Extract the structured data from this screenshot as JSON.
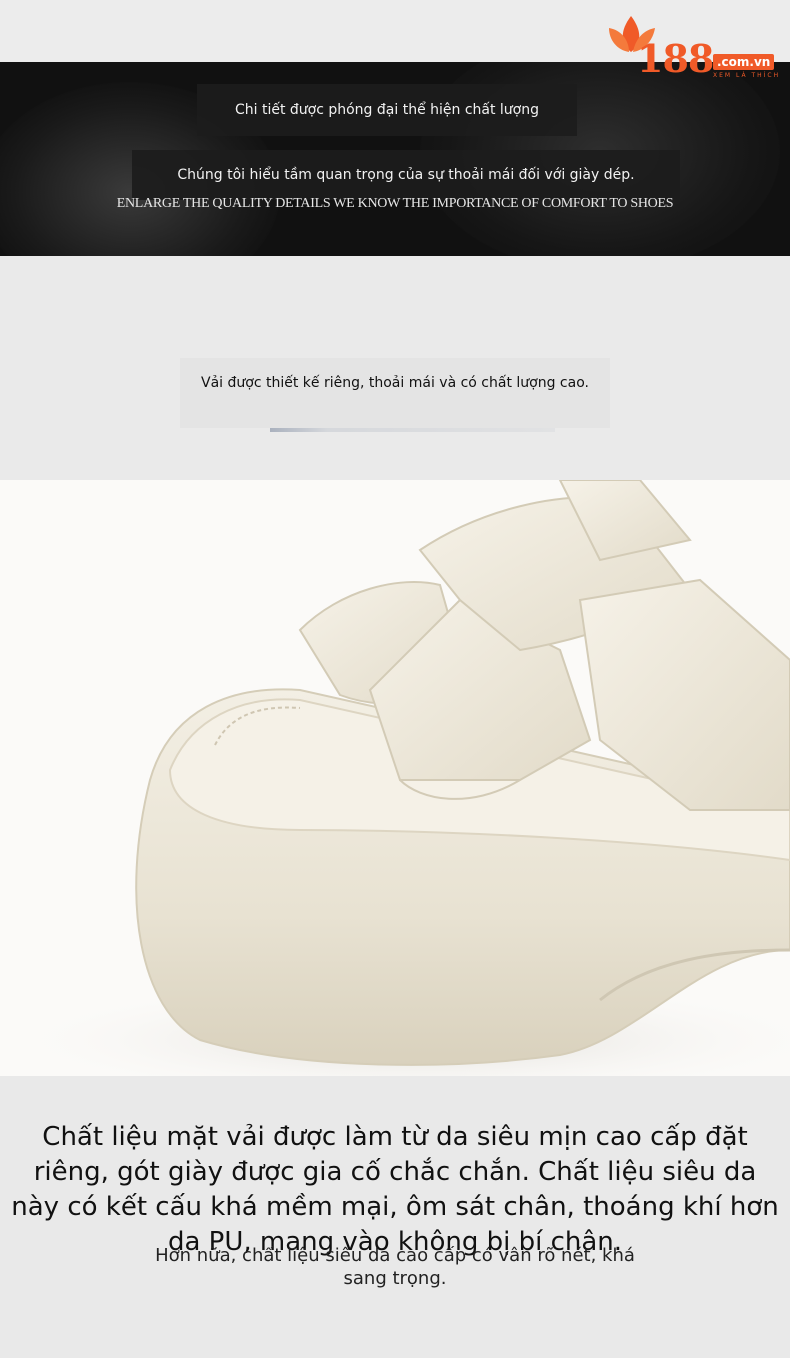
{
  "logo": {
    "number": "188",
    "domain": ".com.vn",
    "tagline": "XEM LÀ THÍCH",
    "colors": {
      "brand": "#f05a28"
    }
  },
  "banner": {
    "vi_line1": "Chi tiết được phóng đại thể hiện chất lượng",
    "vi_line2": "Chúng tôi hiểu tầm quan trọng của sự thoải mái đối với giày dép.",
    "en_line": "ENLARGE THE QUALITY DETAILS WE KNOW THE IMPORTANCE OF COMFORT TO SHOES"
  },
  "fabric_caption": "Vải được thiết kế riêng, thoải mái và có chất lượng cao.",
  "bottom": {
    "main": "Chất liệu mặt vải được làm từ da siêu mịn cao cấp đặt riêng, gót giày được gia cố chắc chắn. Chất liệu siêu da này có kết cấu khá mềm mại, ôm sát chân, thoáng khí hơn da PU, mang vào không bị bí chân.",
    "sub": "Hơn nữa, chất liệu siêu da cao cấp có vân rõ nét, khá sang trọng."
  }
}
